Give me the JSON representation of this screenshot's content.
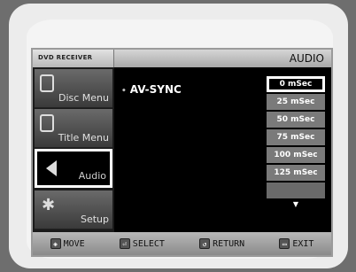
{
  "osd": {
    "brand": "DVD RECEIVER",
    "section_title": "AUDIO"
  },
  "sidebar": {
    "items": [
      {
        "label": "Disc Menu",
        "icon": "disc-menu-icon"
      },
      {
        "label": "Title Menu",
        "icon": "title-menu-icon"
      },
      {
        "label": "Audio",
        "icon": "speaker-icon"
      },
      {
        "label": "Setup",
        "icon": "gear-icon"
      }
    ]
  },
  "main": {
    "setting_label": "AV-SYNC",
    "options": [
      "0 mSec",
      "25 mSec",
      "50 mSec",
      "75 mSec",
      "100 mSec",
      "125 mSec"
    ],
    "selected": "0 mSec"
  },
  "footer": {
    "move": "MOVE",
    "select": "SELECT",
    "return": "RETURN",
    "exit": "EXIT"
  }
}
